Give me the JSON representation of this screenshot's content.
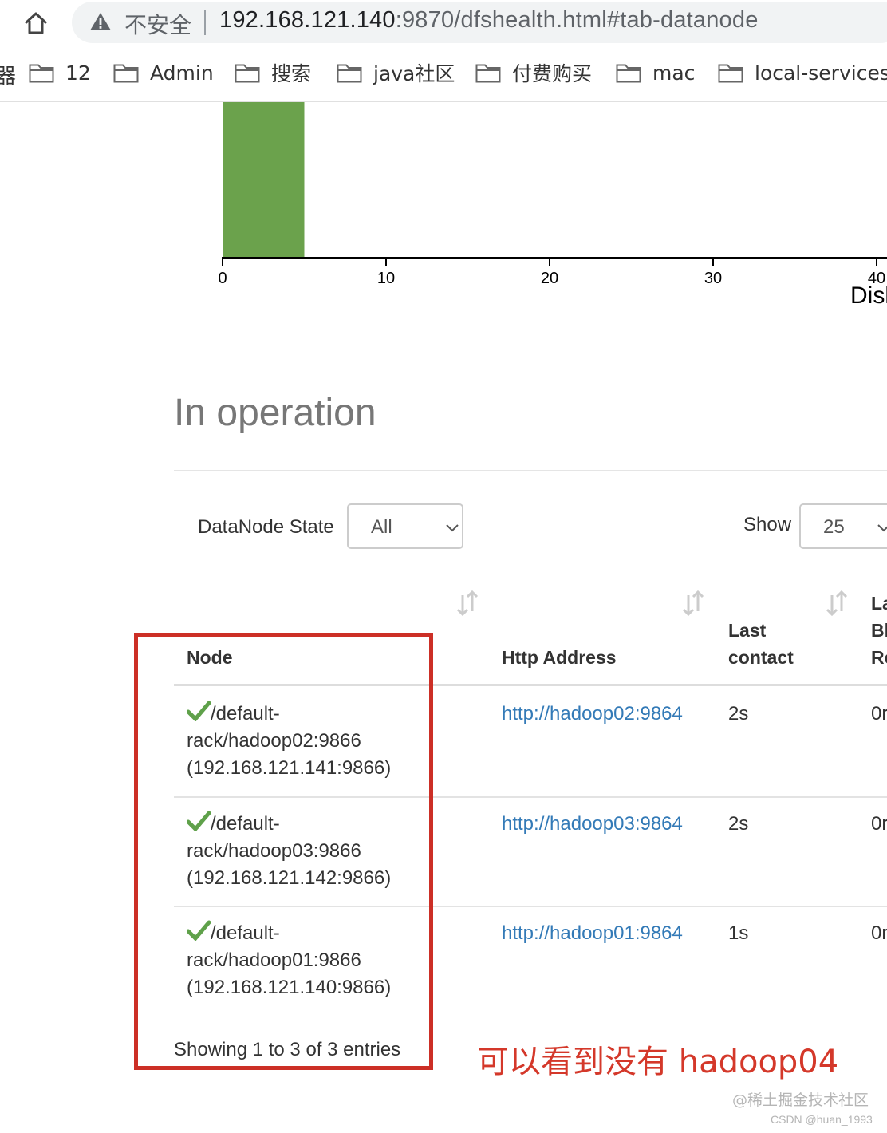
{
  "browser": {
    "security_label": "不安全",
    "url_host": "192.168.121.140",
    "url_rest": ":9870/dfshealth.html#tab-datanode"
  },
  "bookmarks": {
    "edge_fragment": "器",
    "items": [
      {
        "label": "12",
        "icon": "folder-icon"
      },
      {
        "label": "Admin",
        "icon": "folder-icon"
      },
      {
        "label": "搜索",
        "icon": "folder-icon"
      },
      {
        "label": "java社区",
        "icon": "folder-icon"
      },
      {
        "label": "付费购买",
        "icon": "folder-icon"
      },
      {
        "label": "mac",
        "icon": "folder-icon"
      },
      {
        "label": "local-services",
        "icon": "folder-icon"
      }
    ]
  },
  "chart_data": {
    "type": "bar",
    "bins": [
      {
        "x0": 0,
        "x1": 5,
        "count": null
      }
    ],
    "x_ticks": [
      "0",
      "10",
      "20",
      "30",
      "40"
    ],
    "xlim": [
      0,
      40
    ],
    "xlabel_visible": "Disk",
    "bar_color": "#6ba24c",
    "grid": false
  },
  "section": {
    "title": "In operation"
  },
  "filters": {
    "state_label": "DataNode State",
    "state_value": "All",
    "show_label": "Show",
    "show_value": "25"
  },
  "table": {
    "headers": {
      "node": "Node",
      "http": "Http Address",
      "contact_line1": "Last",
      "contact_line2": "contact",
      "last_block_line1": "La",
      "last_block_line2": "Bl",
      "last_block_line3": "Re"
    },
    "rows": [
      {
        "node_line1": "/default-",
        "node_line2": "rack/hadoop02:9866",
        "node_line3": "(192.168.121.141:9866)",
        "http": "http://hadoop02:9864",
        "contact": "2s",
        "last": "0r"
      },
      {
        "node_line1": "/default-",
        "node_line2": "rack/hadoop03:9866",
        "node_line3": "(192.168.121.142:9866)",
        "http": "http://hadoop03:9864",
        "contact": "2s",
        "last": "0r"
      },
      {
        "node_line1": "/default-",
        "node_line2": "rack/hadoop01:9866",
        "node_line3": "(192.168.121.140:9866)",
        "http": "http://hadoop01:9864",
        "contact": "1s",
        "last": "0r"
      }
    ],
    "showing": "Showing 1 to 3 of 3 entries"
  },
  "annotation": {
    "text": "可以看到没有 hadoop04",
    "color": "#d4382a"
  },
  "watermarks": {
    "line1": "@稀土掘金技术社区",
    "line2": "CSDN @huan_1993"
  }
}
